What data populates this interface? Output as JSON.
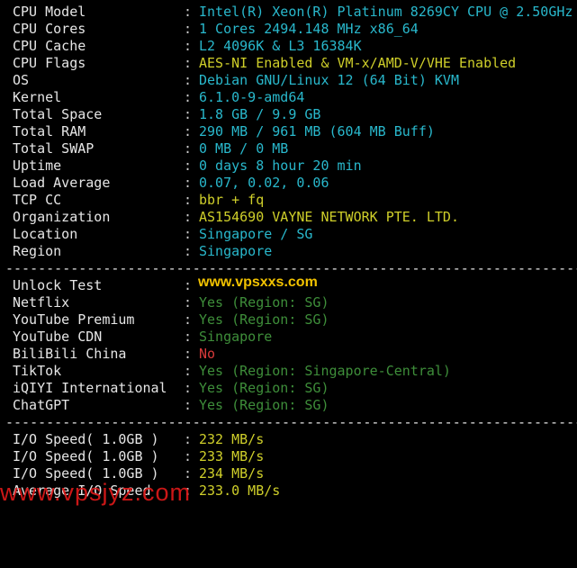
{
  "terminal": {
    "system": [
      {
        "label": "CPU Model",
        "value": "Intel(R) Xeon(R) Platinum 8269CY CPU @ 2.50GHz",
        "color": "cyan"
      },
      {
        "label": "CPU Cores",
        "value": "1 Cores 2494.148 MHz x86_64",
        "color": "cyan"
      },
      {
        "label": "CPU Cache",
        "value": "L2 4096K & L3 16384K",
        "color": "cyan"
      },
      {
        "label": "CPU Flags",
        "value": "AES-NI Enabled & VM-x/AMD-V/VHE Enabled",
        "color": "yellow"
      },
      {
        "label": "OS",
        "value": "Debian GNU/Linux 12 (64 Bit) KVM",
        "color": "cyan"
      },
      {
        "label": "Kernel",
        "value": "6.1.0-9-amd64",
        "color": "cyan"
      },
      {
        "label": "Total Space",
        "value": "1.8 GB / 9.9 GB",
        "color": "cyan"
      },
      {
        "label": "Total RAM",
        "value": "290 MB / 961 MB (604 MB Buff)",
        "color": "cyan"
      },
      {
        "label": "Total SWAP",
        "value": "0 MB / 0 MB",
        "color": "cyan"
      },
      {
        "label": "Uptime",
        "value": "0 days 8 hour 20 min",
        "color": "cyan"
      },
      {
        "label": "Load Average",
        "value": "0.07, 0.02, 0.06",
        "color": "cyan"
      },
      {
        "label": "TCP CC",
        "value": "bbr + fq",
        "color": "yellow"
      },
      {
        "label": "Organization",
        "value": "AS154690 VAYNE NETWORK PTE. LTD.",
        "color": "yellow"
      },
      {
        "label": "Location",
        "value": "Singapore / SG",
        "color": "cyan"
      },
      {
        "label": "Region",
        "value": "Singapore",
        "color": "cyan"
      }
    ],
    "separator": "-----------------------------------------------------------------------",
    "unlock_header": "Unlock Test",
    "watermark_top": "www.vpsxxs.com",
    "unlock": [
      {
        "label": "Netflix",
        "value": "Yes (Region: SG)",
        "color": "green"
      },
      {
        "label": "YouTube Premium",
        "value": "Yes (Region: SG)",
        "color": "green"
      },
      {
        "label": "YouTube CDN",
        "value": "Singapore",
        "color": "green"
      },
      {
        "label": "BiliBili China",
        "value": "No",
        "color": "red"
      },
      {
        "label": "TikTok",
        "value": "Yes (Region: Singapore-Central)",
        "color": "green"
      },
      {
        "label": "iQIYI International",
        "value": "Yes (Region: SG)",
        "color": "green"
      },
      {
        "label": "ChatGPT",
        "value": "Yes (Region: SG)",
        "color": "green"
      }
    ],
    "io": [
      {
        "label": "I/O Speed( 1.0GB )",
        "value": "232 MB/s",
        "color": "yellow"
      },
      {
        "label": "I/O Speed( 1.0GB )",
        "value": "233 MB/s",
        "color": "yellow"
      },
      {
        "label": "I/O Speed( 1.0GB )",
        "value": "234 MB/s",
        "color": "yellow"
      },
      {
        "label": "Average I/O Speed",
        "value": "233.0 MB/s",
        "color": "yellow"
      }
    ],
    "watermark_bottom": "www.vpsjyz.com",
    "colon": ":",
    "colors": {
      "cyan": "#29b8cc",
      "yellow": "#cfcf2a",
      "green": "#3e8e3a",
      "red": "#d83a3a",
      "background": "#000000",
      "text": "#e6e6e6"
    }
  }
}
